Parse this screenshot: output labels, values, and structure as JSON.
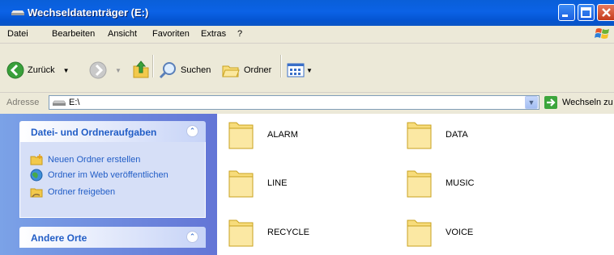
{
  "window": {
    "title": "Wechseldatenträger (E:)",
    "controls": [
      "minimize-icon",
      "maximize-icon",
      "close-icon"
    ]
  },
  "menubar": {
    "items": [
      "Datei",
      "Bearbeiten",
      "Ansicht",
      "Favoriten",
      "Extras",
      "?"
    ]
  },
  "toolbar": {
    "back_label": "Zurück",
    "search_label": "Suchen",
    "folders_label": "Ordner"
  },
  "addressbar": {
    "label": "Adresse",
    "value": "E:\\",
    "go_label": "Wechseln zu"
  },
  "sidebar": {
    "tasks": {
      "title": "Datei- und Ordneraufgaben",
      "items": [
        {
          "label": "Neuen Ordner erstellen",
          "icon": "new-folder-icon"
        },
        {
          "label": "Ordner im Web veröffentlichen",
          "icon": "publish-web-icon"
        },
        {
          "label": "Ordner freigeben",
          "icon": "share-folder-icon"
        }
      ]
    },
    "other_places": {
      "title": "Andere Orte"
    }
  },
  "folders": [
    "ALARM",
    "DATA",
    "LINE",
    "MUSIC",
    "RECYCLE",
    "VOICE"
  ],
  "colors": {
    "titlebar": "#0a5fd8",
    "sidebar_gradient_start": "#7ba2e7",
    "sidebar_gradient_end": "#6375d6",
    "link": "#215dc6",
    "folder": "#f7dc7b"
  }
}
